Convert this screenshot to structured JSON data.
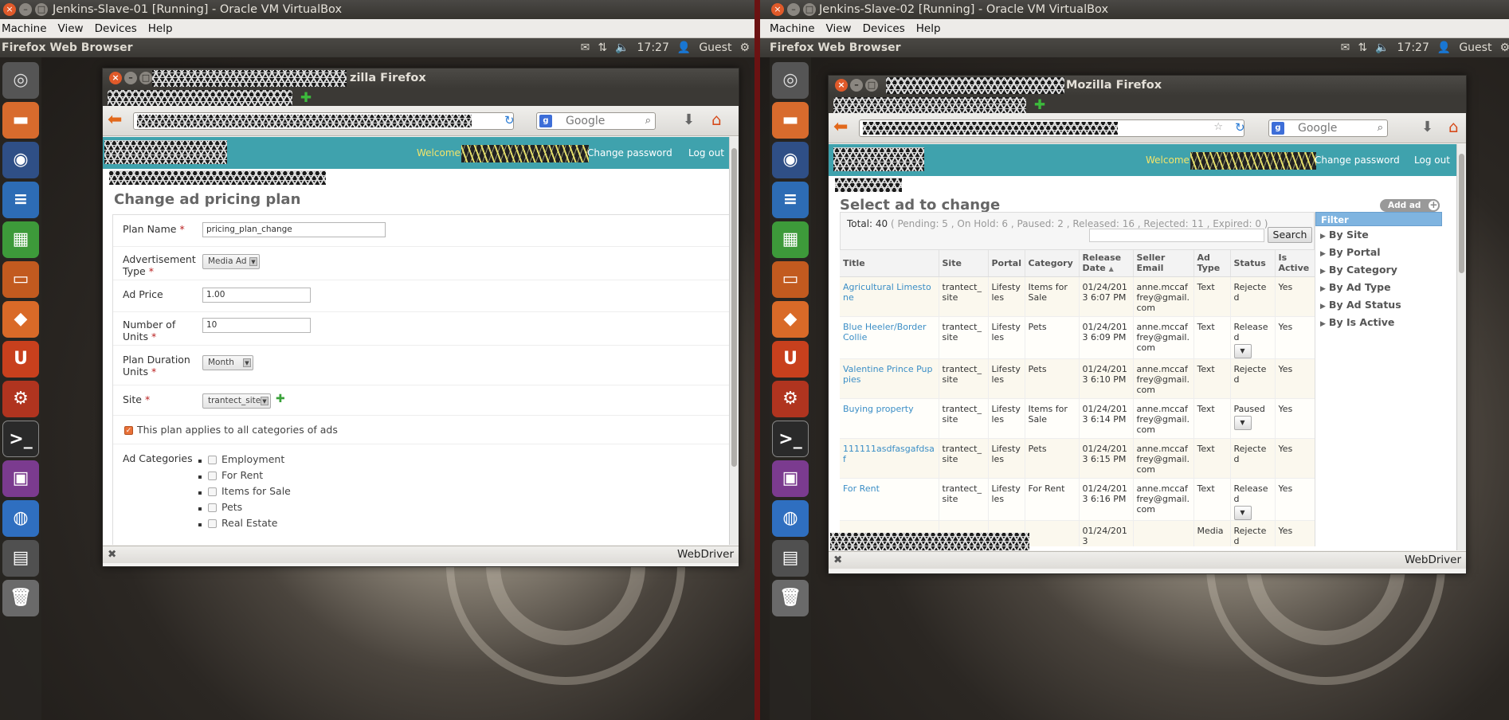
{
  "left": {
    "vm_title": "Jenkins-Slave-01 [Running] - Oracle VM VirtualBox",
    "vm_menu": [
      "Machine",
      "View",
      "Devices",
      "Help"
    ],
    "topbar": {
      "app": "Firefox Web Browser",
      "time": "17:27",
      "user": "Guest"
    },
    "ff_title": "zilla Firefox",
    "search_placeholder": "Google",
    "header": {
      "welcome": "Welcome,",
      "change_password": "Change password",
      "logout": "Log out"
    },
    "heading": "Change ad pricing plan",
    "form": {
      "plan_name": {
        "label": "Plan Name",
        "value": "pricing_plan_change"
      },
      "ad_type": {
        "label": "Advertisement Type",
        "value": "Media Ad"
      },
      "ad_price": {
        "label": "Ad Price",
        "value": "1.00"
      },
      "units": {
        "label": "Number of Units",
        "value": "10"
      },
      "duration": {
        "label": "Plan Duration Units",
        "value": "Month"
      },
      "site": {
        "label": "Site",
        "value": "trantect_site"
      },
      "all_categories": "This plan applies to all categories of ads",
      "categories_label": "Ad Categories",
      "categories": [
        "Employment",
        "For Rent",
        "Items for Sale",
        "Pets",
        "Real Estate"
      ],
      "required_mark": "*"
    },
    "statusbar": {
      "close": "✖",
      "label": "WebDriver"
    }
  },
  "right": {
    "vm_title": "Jenkins-Slave-02 [Running] - Oracle VM VirtualBox",
    "vm_menu": [
      "Machine",
      "View",
      "Devices",
      "Help"
    ],
    "topbar": {
      "app": "Firefox Web Browser",
      "time": "17:27",
      "user": "Guest"
    },
    "ff_title": "Mozilla Firefox",
    "search_placeholder": "Google",
    "header": {
      "welcome": "Welcome,",
      "change_password": "Change password",
      "logout": "Log out"
    },
    "heading": "Select ad to change",
    "add_button": "Add ad",
    "totals": {
      "label": "Total: 40",
      "detail": "( Pending: 5 , On Hold: 6 , Paused: 2 , Released: 16 , Rejected: 11 , Expired: 0 )"
    },
    "search_button": "Search",
    "columns": [
      "Title",
      "Site",
      "Portal",
      "Category",
      "Release Date",
      "Seller Email",
      "Ad Type",
      "Status",
      "Is Active"
    ],
    "rows": [
      {
        "title": "Agricultural Limestone",
        "site": "trantect_site",
        "portal": "Lifestyles",
        "category": "Items for Sale",
        "date": "01/24/2013 6:07 PM",
        "email": "anne.mccaffrey@gmail.com",
        "type": "Text",
        "status": "Rejected",
        "active": "Yes",
        "menu": false
      },
      {
        "title": "Blue Heeler/Border Collie",
        "site": "trantect_site",
        "portal": "Lifestyles",
        "category": "Pets",
        "date": "01/24/2013 6:09 PM",
        "email": "anne.mccaffrey@gmail.com",
        "type": "Text",
        "status": "Released",
        "active": "Yes",
        "menu": true
      },
      {
        "title": "Valentine Prince Puppies",
        "site": "trantect_site",
        "portal": "Lifestyles",
        "category": "Pets",
        "date": "01/24/2013 6:10 PM",
        "email": "anne.mccaffrey@gmail.com",
        "type": "Text",
        "status": "Rejected",
        "active": "Yes",
        "menu": false
      },
      {
        "title": "Buying property",
        "site": "trantect_site",
        "portal": "Lifestyles",
        "category": "Items for Sale",
        "date": "01/24/2013 6:14 PM",
        "email": "anne.mccaffrey@gmail.com",
        "type": "Text",
        "status": "Paused",
        "active": "Yes",
        "menu": true
      },
      {
        "title": "111111asdfasgafdsaf",
        "site": "trantect_site",
        "portal": "Lifestyles",
        "category": "Pets",
        "date": "01/24/2013 6:15 PM",
        "email": "anne.mccaffrey@gmail.com",
        "type": "Text",
        "status": "Rejected",
        "active": "Yes",
        "menu": false
      },
      {
        "title": "For Rent",
        "site": "trantect_site",
        "portal": "Lifestyles",
        "category": "For Rent",
        "date": "01/24/2013 6:16 PM",
        "email": "anne.mccaffrey@gmail.com",
        "type": "Text",
        "status": "Released",
        "active": "Yes",
        "menu": true
      },
      {
        "title": "",
        "site": "",
        "portal": "",
        "category": "",
        "date": "01/24/2013",
        "email": "",
        "type": "Media",
        "status": "Rejected",
        "active": "Yes",
        "menu": false
      }
    ],
    "filter": {
      "title": "Filter",
      "items": [
        "By Site",
        "By Portal",
        "By Category",
        "By Ad Type",
        "By Ad Status",
        "By Is Active"
      ]
    },
    "statusbar": {
      "close": "✖",
      "label": "WebDriver"
    }
  },
  "icons": {
    "launcher": [
      "dash-home-icon",
      "files-icon",
      "firefox-icon",
      "writer-icon",
      "calc-icon",
      "impress-icon",
      "software-center-icon",
      "ubuntu-one-icon",
      "settings-icon",
      "terminal-icon",
      "workspace-switcher-icon",
      "chromium-icon",
      "show-desktop-icon",
      "trash-icon"
    ]
  }
}
